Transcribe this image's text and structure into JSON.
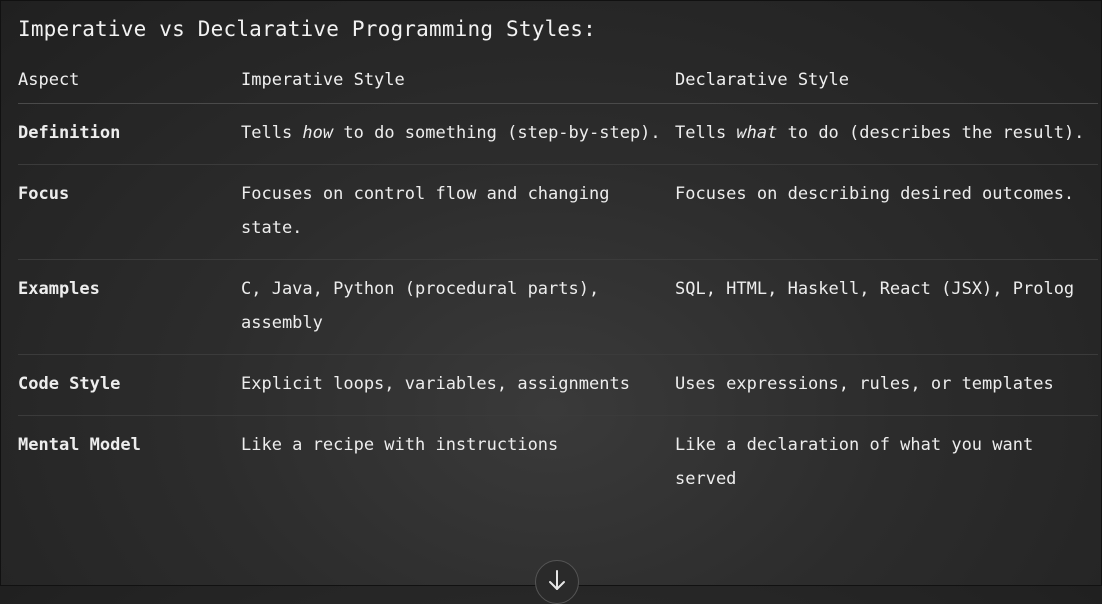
{
  "title": "Imperative vs Declarative Programming Styles:",
  "table": {
    "headers": [
      "Aspect",
      "Imperative Style",
      "Declarative Style"
    ],
    "rows": [
      {
        "aspect": "Definition",
        "imperative": {
          "pre": "Tells ",
          "em": "how",
          "post": " to do something (step-by-step)."
        },
        "declarative": {
          "pre": "Tells ",
          "em": "what",
          "post": " to do (describes the result)."
        }
      },
      {
        "aspect": "Focus",
        "imperative": {
          "pre": "Focuses on control flow and changing state.",
          "em": "",
          "post": ""
        },
        "declarative": {
          "pre": "Focuses on describing desired outcomes.",
          "em": "",
          "post": ""
        }
      },
      {
        "aspect": "Examples",
        "imperative": {
          "pre": "C, Java, Python (procedural parts), assembly",
          "em": "",
          "post": ""
        },
        "declarative": {
          "pre": "SQL, HTML, Haskell, React (JSX), Prolog",
          "em": "",
          "post": ""
        }
      },
      {
        "aspect": "Code Style",
        "imperative": {
          "pre": "Explicit loops, variables, assignments",
          "em": "",
          "post": ""
        },
        "declarative": {
          "pre": "Uses expressions, rules, or templates",
          "em": "",
          "post": ""
        }
      },
      {
        "aspect": "Mental Model",
        "imperative": {
          "pre": "Like a recipe with instructions",
          "em": "",
          "post": ""
        },
        "declarative": {
          "pre": "Like a declaration of what you want served",
          "em": "",
          "post": ""
        }
      }
    ]
  },
  "scroll_button": {
    "icon": "arrow-down-icon"
  }
}
